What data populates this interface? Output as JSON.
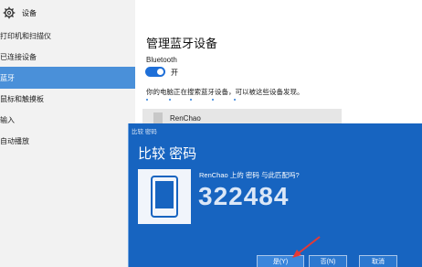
{
  "sidebar": {
    "title": "设备",
    "items": [
      {
        "label": "打印机和扫描仪"
      },
      {
        "label": "已连接设备"
      },
      {
        "label": "蓝牙"
      },
      {
        "label": "鼠标和触摸板"
      },
      {
        "label": "输入"
      },
      {
        "label": "自动播放"
      }
    ],
    "active_index": 2
  },
  "main": {
    "heading": "管理蓝牙设备",
    "bluetooth_label": "Bluetooth",
    "toggle_state": "开",
    "search_status": "你的电脑正在搜索蓝牙设备，可以被这些设备发现。",
    "device_name": "RenChao"
  },
  "dialog": {
    "window_title": "比较 密码",
    "heading": "比较 密码",
    "message": "RenChao 上的 密码 与此匹配吗?",
    "passcode": "322484",
    "yes_label": "是(Y)",
    "no_label": "否(N)",
    "cancel_label": "取消"
  },
  "colors": {
    "accent": "#1e6fd8",
    "dialog_bg": "#1764c0",
    "sidebar_active": "#4a90d9",
    "annotation_arrow": "#e53935"
  }
}
